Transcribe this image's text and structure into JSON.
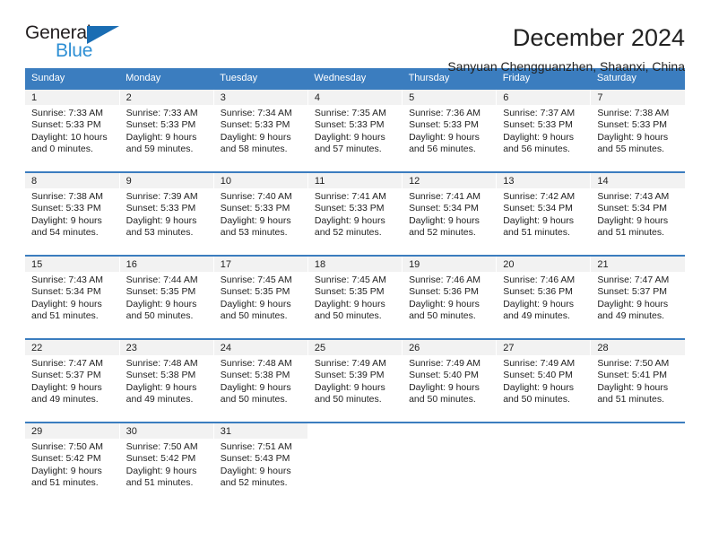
{
  "brand": {
    "name_part1": "General",
    "name_part2": "Blue",
    "triangle_color": "#1a6db3",
    "blue_color": "#2e8fd4"
  },
  "header": {
    "title": "December 2024",
    "subtitle": "Sanyuan Chengguanzhen, Shaanxi, China",
    "accent_color": "#3b7dbf",
    "band_color": "#f2f2f2"
  },
  "weekdays": [
    "Sunday",
    "Monday",
    "Tuesday",
    "Wednesday",
    "Thursday",
    "Friday",
    "Saturday"
  ],
  "weeks": [
    [
      {
        "day": "1",
        "sunrise": "Sunrise: 7:33 AM",
        "sunset": "Sunset: 5:33 PM",
        "daylight_line1": "Daylight: 10 hours",
        "daylight_line2": "and 0 minutes."
      },
      {
        "day": "2",
        "sunrise": "Sunrise: 7:33 AM",
        "sunset": "Sunset: 5:33 PM",
        "daylight_line1": "Daylight: 9 hours",
        "daylight_line2": "and 59 minutes."
      },
      {
        "day": "3",
        "sunrise": "Sunrise: 7:34 AM",
        "sunset": "Sunset: 5:33 PM",
        "daylight_line1": "Daylight: 9 hours",
        "daylight_line2": "and 58 minutes."
      },
      {
        "day": "4",
        "sunrise": "Sunrise: 7:35 AM",
        "sunset": "Sunset: 5:33 PM",
        "daylight_line1": "Daylight: 9 hours",
        "daylight_line2": "and 57 minutes."
      },
      {
        "day": "5",
        "sunrise": "Sunrise: 7:36 AM",
        "sunset": "Sunset: 5:33 PM",
        "daylight_line1": "Daylight: 9 hours",
        "daylight_line2": "and 56 minutes."
      },
      {
        "day": "6",
        "sunrise": "Sunrise: 7:37 AM",
        "sunset": "Sunset: 5:33 PM",
        "daylight_line1": "Daylight: 9 hours",
        "daylight_line2": "and 56 minutes."
      },
      {
        "day": "7",
        "sunrise": "Sunrise: 7:38 AM",
        "sunset": "Sunset: 5:33 PM",
        "daylight_line1": "Daylight: 9 hours",
        "daylight_line2": "and 55 minutes."
      }
    ],
    [
      {
        "day": "8",
        "sunrise": "Sunrise: 7:38 AM",
        "sunset": "Sunset: 5:33 PM",
        "daylight_line1": "Daylight: 9 hours",
        "daylight_line2": "and 54 minutes."
      },
      {
        "day": "9",
        "sunrise": "Sunrise: 7:39 AM",
        "sunset": "Sunset: 5:33 PM",
        "daylight_line1": "Daylight: 9 hours",
        "daylight_line2": "and 53 minutes."
      },
      {
        "day": "10",
        "sunrise": "Sunrise: 7:40 AM",
        "sunset": "Sunset: 5:33 PM",
        "daylight_line1": "Daylight: 9 hours",
        "daylight_line2": "and 53 minutes."
      },
      {
        "day": "11",
        "sunrise": "Sunrise: 7:41 AM",
        "sunset": "Sunset: 5:33 PM",
        "daylight_line1": "Daylight: 9 hours",
        "daylight_line2": "and 52 minutes."
      },
      {
        "day": "12",
        "sunrise": "Sunrise: 7:41 AM",
        "sunset": "Sunset: 5:34 PM",
        "daylight_line1": "Daylight: 9 hours",
        "daylight_line2": "and 52 minutes."
      },
      {
        "day": "13",
        "sunrise": "Sunrise: 7:42 AM",
        "sunset": "Sunset: 5:34 PM",
        "daylight_line1": "Daylight: 9 hours",
        "daylight_line2": "and 51 minutes."
      },
      {
        "day": "14",
        "sunrise": "Sunrise: 7:43 AM",
        "sunset": "Sunset: 5:34 PM",
        "daylight_line1": "Daylight: 9 hours",
        "daylight_line2": "and 51 minutes."
      }
    ],
    [
      {
        "day": "15",
        "sunrise": "Sunrise: 7:43 AM",
        "sunset": "Sunset: 5:34 PM",
        "daylight_line1": "Daylight: 9 hours",
        "daylight_line2": "and 51 minutes."
      },
      {
        "day": "16",
        "sunrise": "Sunrise: 7:44 AM",
        "sunset": "Sunset: 5:35 PM",
        "daylight_line1": "Daylight: 9 hours",
        "daylight_line2": "and 50 minutes."
      },
      {
        "day": "17",
        "sunrise": "Sunrise: 7:45 AM",
        "sunset": "Sunset: 5:35 PM",
        "daylight_line1": "Daylight: 9 hours",
        "daylight_line2": "and 50 minutes."
      },
      {
        "day": "18",
        "sunrise": "Sunrise: 7:45 AM",
        "sunset": "Sunset: 5:35 PM",
        "daylight_line1": "Daylight: 9 hours",
        "daylight_line2": "and 50 minutes."
      },
      {
        "day": "19",
        "sunrise": "Sunrise: 7:46 AM",
        "sunset": "Sunset: 5:36 PM",
        "daylight_line1": "Daylight: 9 hours",
        "daylight_line2": "and 50 minutes."
      },
      {
        "day": "20",
        "sunrise": "Sunrise: 7:46 AM",
        "sunset": "Sunset: 5:36 PM",
        "daylight_line1": "Daylight: 9 hours",
        "daylight_line2": "and 49 minutes."
      },
      {
        "day": "21",
        "sunrise": "Sunrise: 7:47 AM",
        "sunset": "Sunset: 5:37 PM",
        "daylight_line1": "Daylight: 9 hours",
        "daylight_line2": "and 49 minutes."
      }
    ],
    [
      {
        "day": "22",
        "sunrise": "Sunrise: 7:47 AM",
        "sunset": "Sunset: 5:37 PM",
        "daylight_line1": "Daylight: 9 hours",
        "daylight_line2": "and 49 minutes."
      },
      {
        "day": "23",
        "sunrise": "Sunrise: 7:48 AM",
        "sunset": "Sunset: 5:38 PM",
        "daylight_line1": "Daylight: 9 hours",
        "daylight_line2": "and 49 minutes."
      },
      {
        "day": "24",
        "sunrise": "Sunrise: 7:48 AM",
        "sunset": "Sunset: 5:38 PM",
        "daylight_line1": "Daylight: 9 hours",
        "daylight_line2": "and 50 minutes."
      },
      {
        "day": "25",
        "sunrise": "Sunrise: 7:49 AM",
        "sunset": "Sunset: 5:39 PM",
        "daylight_line1": "Daylight: 9 hours",
        "daylight_line2": "and 50 minutes."
      },
      {
        "day": "26",
        "sunrise": "Sunrise: 7:49 AM",
        "sunset": "Sunset: 5:40 PM",
        "daylight_line1": "Daylight: 9 hours",
        "daylight_line2": "and 50 minutes."
      },
      {
        "day": "27",
        "sunrise": "Sunrise: 7:49 AM",
        "sunset": "Sunset: 5:40 PM",
        "daylight_line1": "Daylight: 9 hours",
        "daylight_line2": "and 50 minutes."
      },
      {
        "day": "28",
        "sunrise": "Sunrise: 7:50 AM",
        "sunset": "Sunset: 5:41 PM",
        "daylight_line1": "Daylight: 9 hours",
        "daylight_line2": "and 51 minutes."
      }
    ],
    [
      {
        "day": "29",
        "sunrise": "Sunrise: 7:50 AM",
        "sunset": "Sunset: 5:42 PM",
        "daylight_line1": "Daylight: 9 hours",
        "daylight_line2": "and 51 minutes."
      },
      {
        "day": "30",
        "sunrise": "Sunrise: 7:50 AM",
        "sunset": "Sunset: 5:42 PM",
        "daylight_line1": "Daylight: 9 hours",
        "daylight_line2": "and 51 minutes."
      },
      {
        "day": "31",
        "sunrise": "Sunrise: 7:51 AM",
        "sunset": "Sunset: 5:43 PM",
        "daylight_line1": "Daylight: 9 hours",
        "daylight_line2": "and 52 minutes."
      },
      {
        "day": "",
        "sunrise": "",
        "sunset": "",
        "daylight_line1": "",
        "daylight_line2": ""
      },
      {
        "day": "",
        "sunrise": "",
        "sunset": "",
        "daylight_line1": "",
        "daylight_line2": ""
      },
      {
        "day": "",
        "sunrise": "",
        "sunset": "",
        "daylight_line1": "",
        "daylight_line2": ""
      },
      {
        "day": "",
        "sunrise": "",
        "sunset": "",
        "daylight_line1": "",
        "daylight_line2": ""
      }
    ]
  ]
}
